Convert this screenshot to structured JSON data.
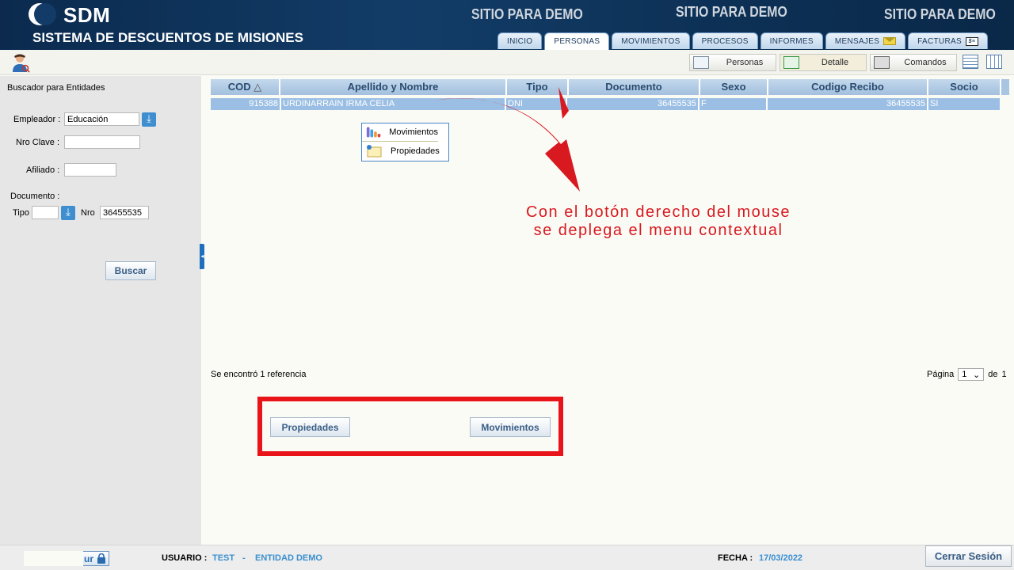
{
  "header": {
    "app_short": "SDM",
    "app_long": "SISTEMA DE DESCUENTOS DE MISIONES",
    "demo_labels": [
      "SITIO PARA DEMO",
      "SITIO PARA DEMO",
      "SITIO PARA DEMO"
    ],
    "tabs": [
      {
        "label": "INICIO"
      },
      {
        "label": "PERSONAS",
        "active": true
      },
      {
        "label": "MOVIMIENTOS"
      },
      {
        "label": "PROCESOS"
      },
      {
        "label": "INFORMES"
      },
      {
        "label": "MENSAJES",
        "icon": "envelope-icon"
      },
      {
        "label": "FACTURAS",
        "icon": "invoice-icon"
      }
    ]
  },
  "toolbar": {
    "personas_label": "Personas",
    "detalle_label": "Detalle",
    "comandos_label": "Comandos"
  },
  "search": {
    "title": "Buscador para Entidades",
    "empleador_label": "Empleador :",
    "empleador_value": "Educación",
    "nro_clave_label": "Nro Clave :",
    "nro_clave_value": "",
    "afiliado_label": "Afiliado :",
    "afiliado_value": "",
    "documento_label": "Documento :",
    "tipo_label": "Tipo",
    "tipo_value": "",
    "nro_label": "Nro",
    "nro_value": "36455535",
    "buscar_label": "Buscar"
  },
  "table": {
    "columns": [
      "COD",
      "Apellido y Nombre",
      "Tipo",
      "Documento",
      "Sexo",
      "Codigo Recibo",
      "Socio"
    ],
    "sort_indicator": "△",
    "rows": [
      {
        "cod": "915388",
        "nombre": "URDINARRAIN IRMA CELIA",
        "tipo": "DNI",
        "documento": "36455535",
        "sexo": "F",
        "codigo_recibo": "36455535",
        "socio": "SI"
      }
    ]
  },
  "context_menu": {
    "items": [
      {
        "label": "Movimientos",
        "icon": "movements-icon"
      },
      {
        "label": "Propiedades",
        "icon": "properties-icon"
      }
    ]
  },
  "annotation": {
    "line1": "Con el botón derecho del mouse",
    "line2": "se deplega el menu contextual",
    "color": "#d8191f"
  },
  "results": {
    "found_text": "Se encontró 1 referencia",
    "page_label": "Página",
    "page_value": "1",
    "of_label": "de",
    "total_pages": "1"
  },
  "actions": {
    "propiedades_label": "Propiedades",
    "movimientos_label": "Movimientos"
  },
  "footer": {
    "lock_text": "ur",
    "usuario_label": "USUARIO :",
    "usuario_value": "TEST",
    "separator": "-",
    "entidad_value": "ENTIDAD DEMO",
    "fecha_label": "FECHA :",
    "fecha_value": "17/03/2022",
    "cerrar_label": "Cerrar Sesión"
  }
}
